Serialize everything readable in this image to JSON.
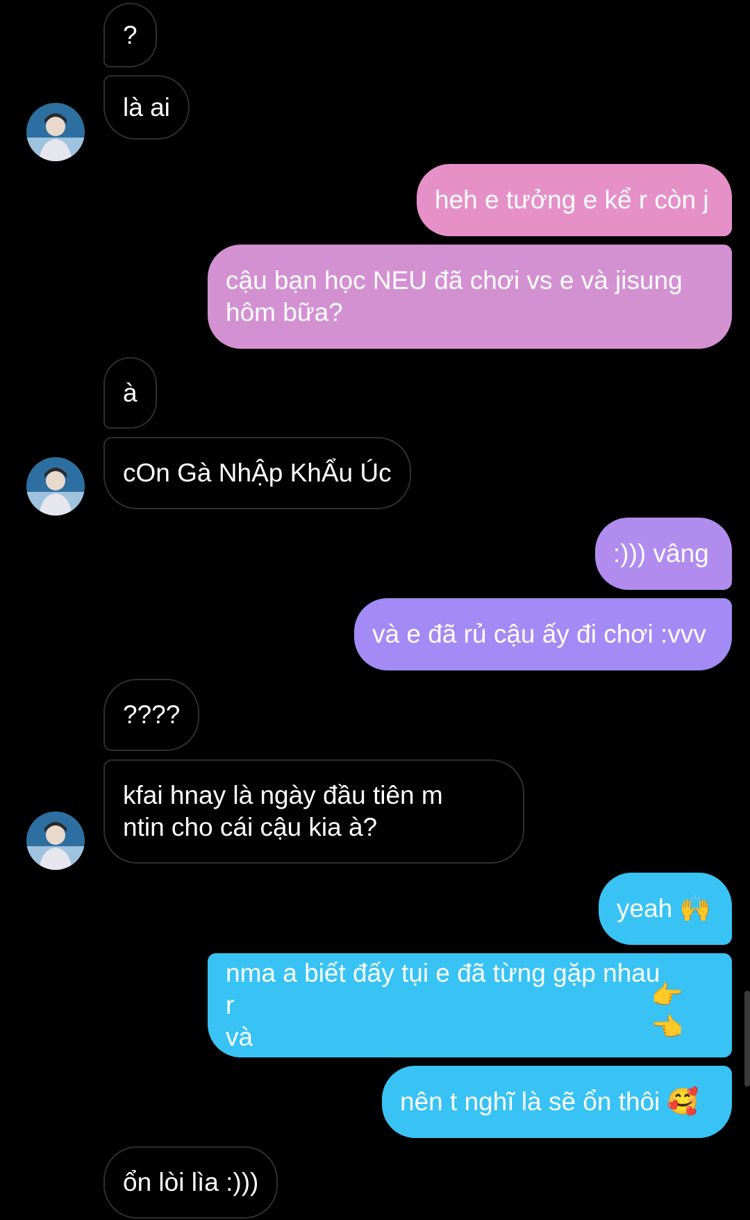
{
  "messages": [
    {
      "id": "m1",
      "text": "?"
    },
    {
      "id": "m2",
      "text": "là ai"
    },
    {
      "id": "m3",
      "text": "heh e tưởng e kể r còn j"
    },
    {
      "id": "m4",
      "text": "cậu bạn học NEU đã chơi vs e và jisung\nhôm bữa?"
    },
    {
      "id": "m5",
      "text": "à"
    },
    {
      "id": "m6",
      "text": "cOn Gà NhẬp KhẨu Úc"
    },
    {
      "id": "m7",
      "text": ":))) vâng"
    },
    {
      "id": "m8",
      "text": "và e đã rủ cậu ấy đi chơi :vvv"
    },
    {
      "id": "m9",
      "text": "????"
    },
    {
      "id": "m10",
      "text": "kfai hnay là ngày đầu tiên m\nntin cho cái cậu kia à?"
    },
    {
      "id": "m11",
      "text": "yeah",
      "emoji": "🙌"
    },
    {
      "id": "m12",
      "text": "nma a biết đấy tụi e đã từng gặp nhau r\nvà",
      "emoji": "👉👈"
    },
    {
      "id": "m13",
      "text": "nên t nghĩ là sẽ ổn thôi",
      "emoji": "🥰"
    },
    {
      "id": "m14",
      "text": "ổn lòi lìa :)))"
    }
  ],
  "colors": {
    "incoming_bg": "#000000",
    "incoming_border": "#2f2f2f",
    "outgoing_gradient": [
      "#e591c8",
      "#cf8fe0",
      "#a88af2",
      "#3fc1f5"
    ]
  }
}
